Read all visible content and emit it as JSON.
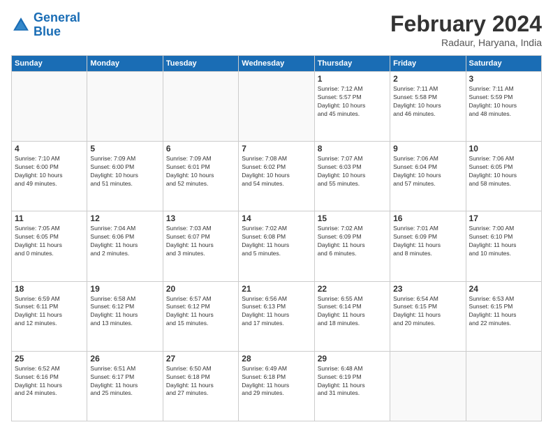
{
  "header": {
    "logo_general": "General",
    "logo_blue": "Blue",
    "month_title": "February 2024",
    "location": "Radaur, Haryana, India"
  },
  "days_of_week": [
    "Sunday",
    "Monday",
    "Tuesday",
    "Wednesday",
    "Thursday",
    "Friday",
    "Saturday"
  ],
  "weeks": [
    [
      {
        "day": "",
        "info": ""
      },
      {
        "day": "",
        "info": ""
      },
      {
        "day": "",
        "info": ""
      },
      {
        "day": "",
        "info": ""
      },
      {
        "day": "1",
        "info": "Sunrise: 7:12 AM\nSunset: 5:57 PM\nDaylight: 10 hours\nand 45 minutes."
      },
      {
        "day": "2",
        "info": "Sunrise: 7:11 AM\nSunset: 5:58 PM\nDaylight: 10 hours\nand 46 minutes."
      },
      {
        "day": "3",
        "info": "Sunrise: 7:11 AM\nSunset: 5:59 PM\nDaylight: 10 hours\nand 48 minutes."
      }
    ],
    [
      {
        "day": "4",
        "info": "Sunrise: 7:10 AM\nSunset: 6:00 PM\nDaylight: 10 hours\nand 49 minutes."
      },
      {
        "day": "5",
        "info": "Sunrise: 7:09 AM\nSunset: 6:00 PM\nDaylight: 10 hours\nand 51 minutes."
      },
      {
        "day": "6",
        "info": "Sunrise: 7:09 AM\nSunset: 6:01 PM\nDaylight: 10 hours\nand 52 minutes."
      },
      {
        "day": "7",
        "info": "Sunrise: 7:08 AM\nSunset: 6:02 PM\nDaylight: 10 hours\nand 54 minutes."
      },
      {
        "day": "8",
        "info": "Sunrise: 7:07 AM\nSunset: 6:03 PM\nDaylight: 10 hours\nand 55 minutes."
      },
      {
        "day": "9",
        "info": "Sunrise: 7:06 AM\nSunset: 6:04 PM\nDaylight: 10 hours\nand 57 minutes."
      },
      {
        "day": "10",
        "info": "Sunrise: 7:06 AM\nSunset: 6:05 PM\nDaylight: 10 hours\nand 58 minutes."
      }
    ],
    [
      {
        "day": "11",
        "info": "Sunrise: 7:05 AM\nSunset: 6:05 PM\nDaylight: 11 hours\nand 0 minutes."
      },
      {
        "day": "12",
        "info": "Sunrise: 7:04 AM\nSunset: 6:06 PM\nDaylight: 11 hours\nand 2 minutes."
      },
      {
        "day": "13",
        "info": "Sunrise: 7:03 AM\nSunset: 6:07 PM\nDaylight: 11 hours\nand 3 minutes."
      },
      {
        "day": "14",
        "info": "Sunrise: 7:02 AM\nSunset: 6:08 PM\nDaylight: 11 hours\nand 5 minutes."
      },
      {
        "day": "15",
        "info": "Sunrise: 7:02 AM\nSunset: 6:09 PM\nDaylight: 11 hours\nand 6 minutes."
      },
      {
        "day": "16",
        "info": "Sunrise: 7:01 AM\nSunset: 6:09 PM\nDaylight: 11 hours\nand 8 minutes."
      },
      {
        "day": "17",
        "info": "Sunrise: 7:00 AM\nSunset: 6:10 PM\nDaylight: 11 hours\nand 10 minutes."
      }
    ],
    [
      {
        "day": "18",
        "info": "Sunrise: 6:59 AM\nSunset: 6:11 PM\nDaylight: 11 hours\nand 12 minutes."
      },
      {
        "day": "19",
        "info": "Sunrise: 6:58 AM\nSunset: 6:12 PM\nDaylight: 11 hours\nand 13 minutes."
      },
      {
        "day": "20",
        "info": "Sunrise: 6:57 AM\nSunset: 6:12 PM\nDaylight: 11 hours\nand 15 minutes."
      },
      {
        "day": "21",
        "info": "Sunrise: 6:56 AM\nSunset: 6:13 PM\nDaylight: 11 hours\nand 17 minutes."
      },
      {
        "day": "22",
        "info": "Sunrise: 6:55 AM\nSunset: 6:14 PM\nDaylight: 11 hours\nand 18 minutes."
      },
      {
        "day": "23",
        "info": "Sunrise: 6:54 AM\nSunset: 6:15 PM\nDaylight: 11 hours\nand 20 minutes."
      },
      {
        "day": "24",
        "info": "Sunrise: 6:53 AM\nSunset: 6:15 PM\nDaylight: 11 hours\nand 22 minutes."
      }
    ],
    [
      {
        "day": "25",
        "info": "Sunrise: 6:52 AM\nSunset: 6:16 PM\nDaylight: 11 hours\nand 24 minutes."
      },
      {
        "day": "26",
        "info": "Sunrise: 6:51 AM\nSunset: 6:17 PM\nDaylight: 11 hours\nand 25 minutes."
      },
      {
        "day": "27",
        "info": "Sunrise: 6:50 AM\nSunset: 6:18 PM\nDaylight: 11 hours\nand 27 minutes."
      },
      {
        "day": "28",
        "info": "Sunrise: 6:49 AM\nSunset: 6:18 PM\nDaylight: 11 hours\nand 29 minutes."
      },
      {
        "day": "29",
        "info": "Sunrise: 6:48 AM\nSunset: 6:19 PM\nDaylight: 11 hours\nand 31 minutes."
      },
      {
        "day": "",
        "info": ""
      },
      {
        "day": "",
        "info": ""
      }
    ]
  ]
}
